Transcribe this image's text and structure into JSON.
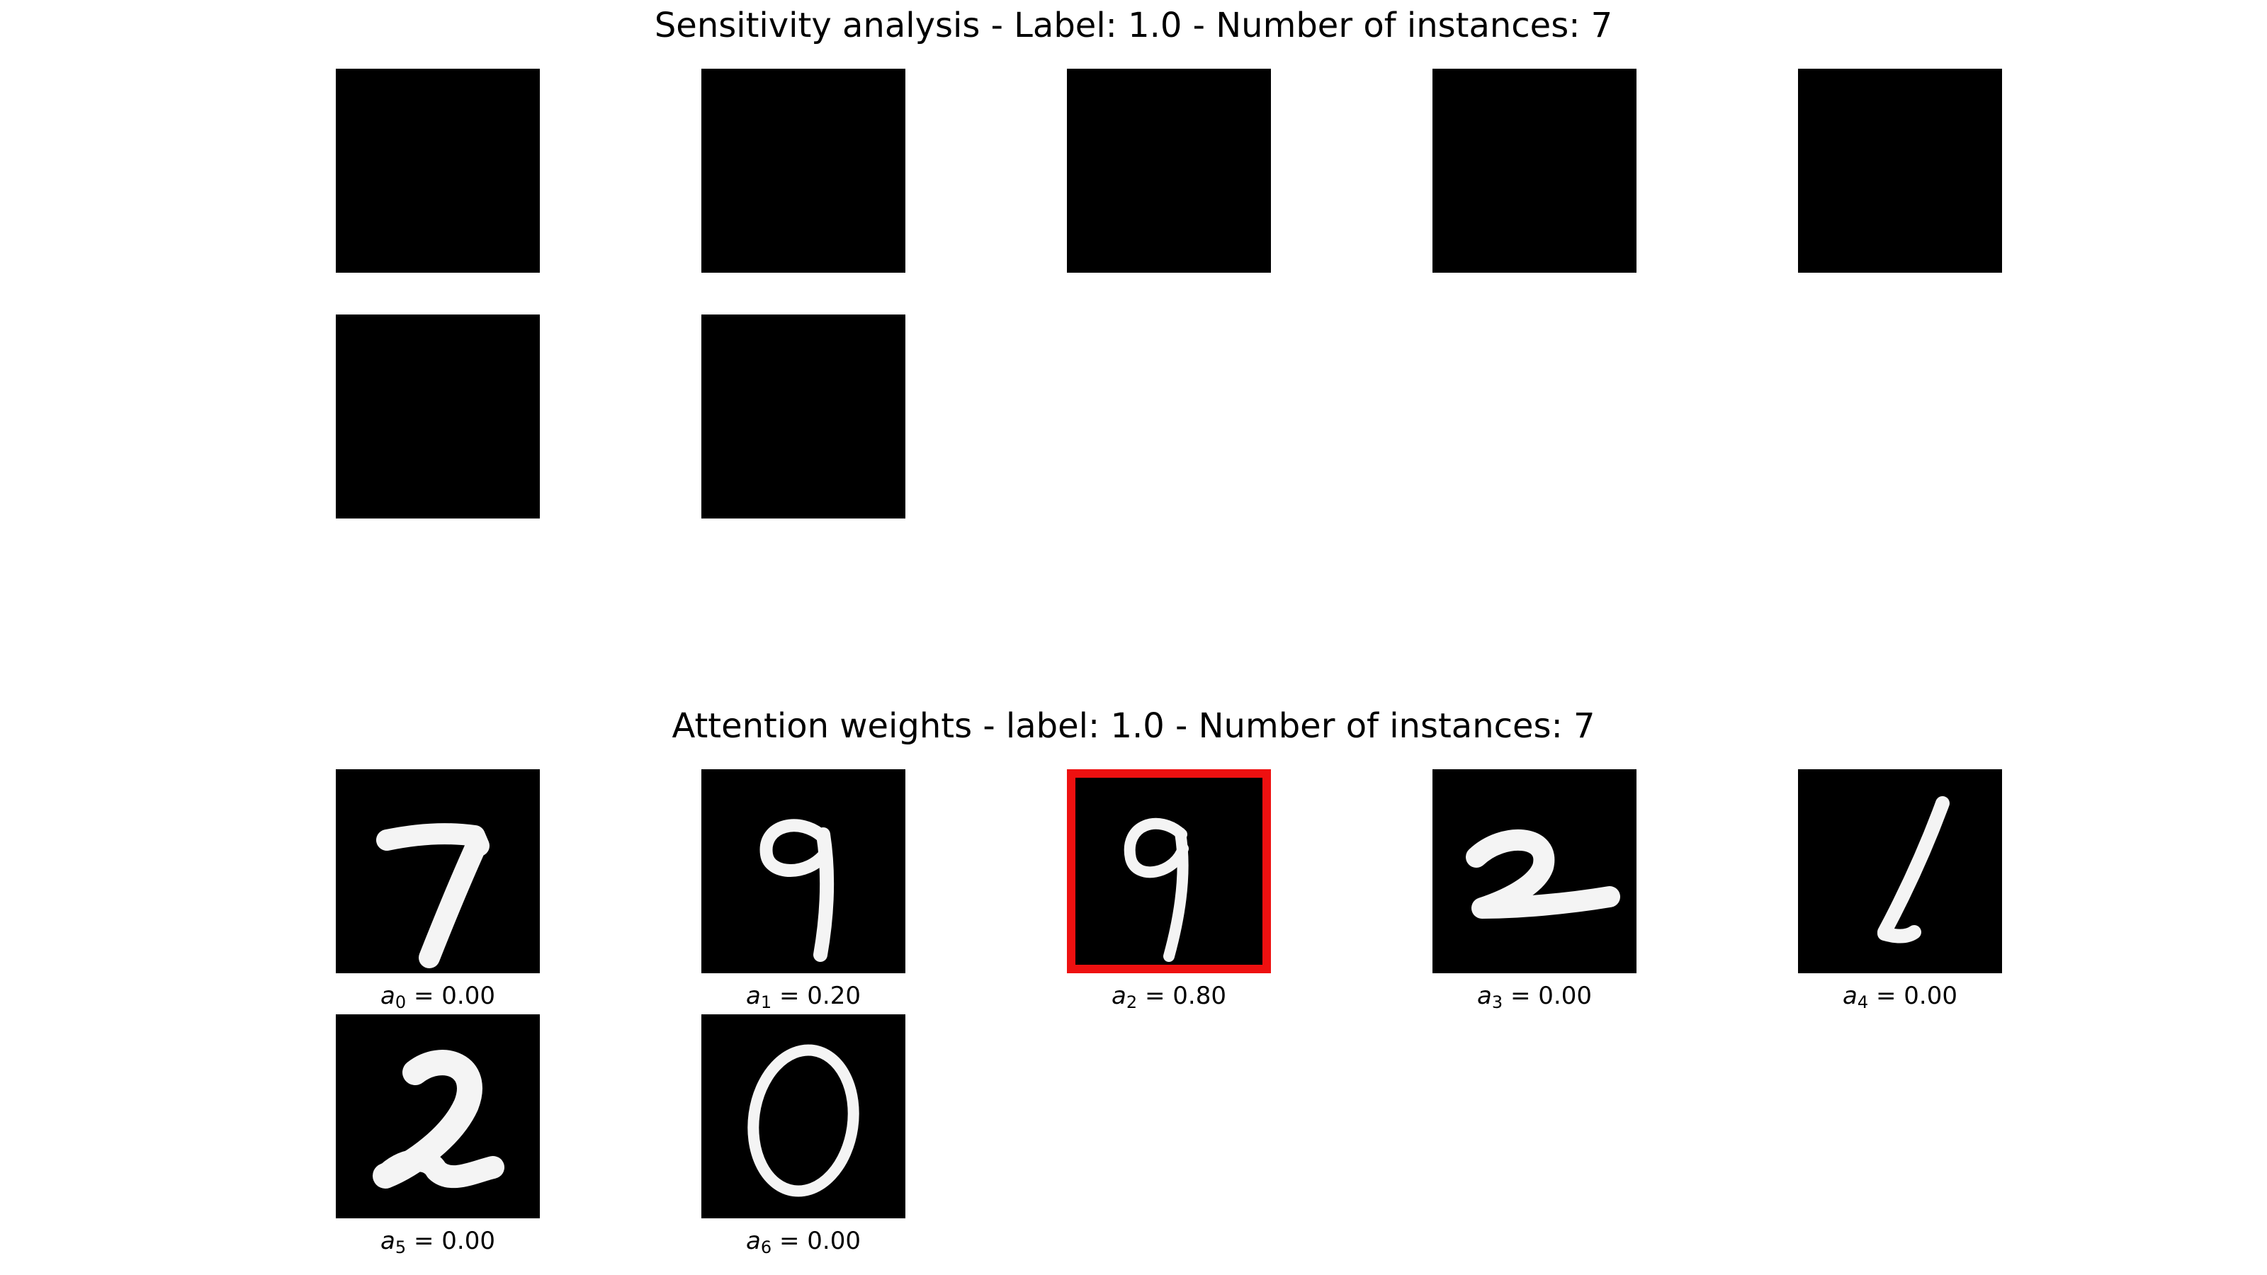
{
  "sensitivity": {
    "title": "Sensitivity analysis - Label: 1.0 - Number of instances: 7",
    "tiles": [
      {
        "index": "0"
      },
      {
        "index": "1"
      },
      {
        "index": "2"
      },
      {
        "index": "3"
      },
      {
        "index": "4"
      },
      {
        "index": "5"
      },
      {
        "index": "6"
      }
    ]
  },
  "attention": {
    "title": "Attention weights - label: 1.0 - Number of instances: 7",
    "highlight_color": "#ee1010",
    "tiles": [
      {
        "digit": "7",
        "symbol": "a",
        "subscript": "0",
        "eq": "=",
        "value": "0.00",
        "highlighted": false
      },
      {
        "digit": "9",
        "symbol": "a",
        "subscript": "1",
        "eq": "=",
        "value": "0.20",
        "highlighted": false
      },
      {
        "digit": "9",
        "symbol": "a",
        "subscript": "2",
        "eq": "=",
        "value": "0.80",
        "highlighted": true
      },
      {
        "digit": "2",
        "symbol": "a",
        "subscript": "3",
        "eq": "=",
        "value": "0.00",
        "highlighted": false
      },
      {
        "digit": "1",
        "symbol": "a",
        "subscript": "4",
        "eq": "=",
        "value": "0.00",
        "highlighted": false
      },
      {
        "digit": "2",
        "symbol": "a",
        "subscript": "5",
        "eq": "=",
        "value": "0.00",
        "highlighted": false
      },
      {
        "digit": "0",
        "symbol": "a",
        "subscript": "6",
        "eq": "=",
        "value": "0.00",
        "highlighted": false
      }
    ]
  }
}
